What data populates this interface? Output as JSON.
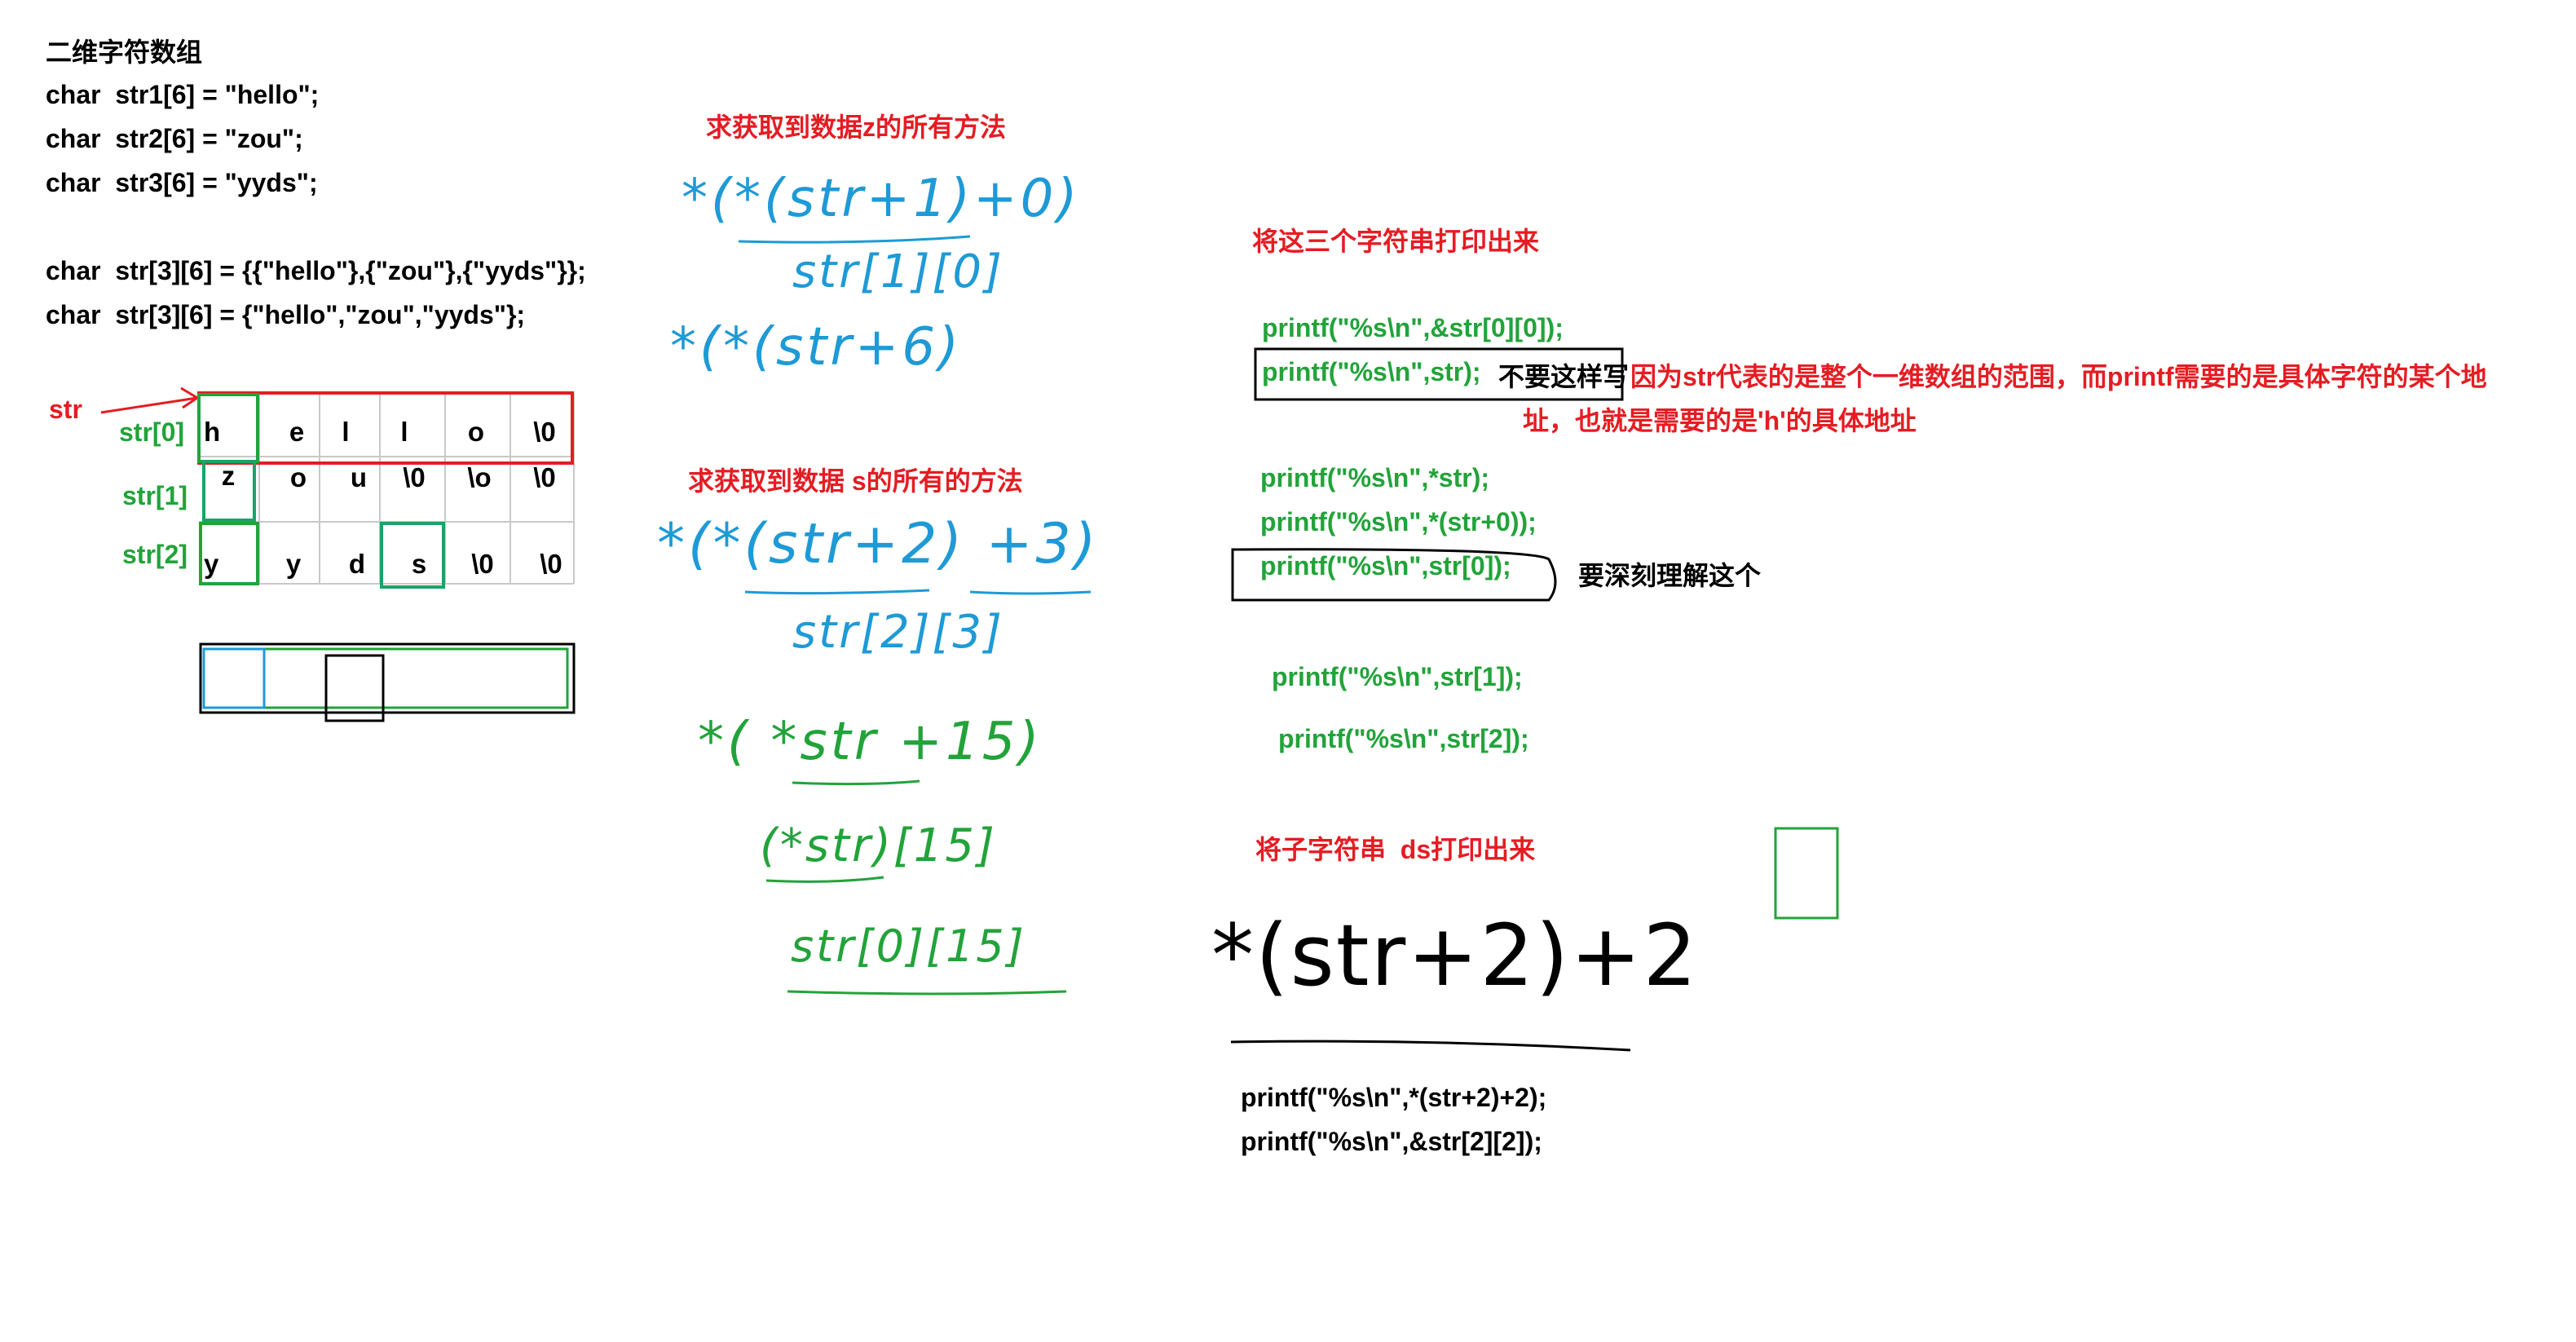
{
  "left": {
    "title": "二维字符数组",
    "code": [
      "char  str1[6] = \"hello\";",
      "char  str2[6] = \"zou\";",
      "char  str3[6] = \"yyds\";",
      "char  str[3][6] = {{\"hello\"},{\"zou\"},{\"yyds\"}};",
      "char  str[3][6] = {\"hello\",\"zou\",\"yyds\"};"
    ],
    "pointer_label": "str",
    "row_labels": [
      "str[0]",
      "str[1]",
      "str[2]"
    ],
    "grid": [
      [
        "h",
        "e",
        "l",
        "l",
        "o",
        "\\0"
      ],
      [
        "z",
        "o",
        "u",
        "\\0",
        "\\o",
        "\\0"
      ],
      [
        "y",
        "y",
        "d",
        "s",
        "\\0",
        "\\0"
      ]
    ]
  },
  "middle": {
    "heading_z": "求获取到数据z的所有方法",
    "hand_z": [
      "*(*(str+1)+0)",
      "str[1][0]",
      "*(*(str+6)"
    ],
    "heading_s": "求获取到数据 s的所有的方法",
    "hand_s": [
      "*(*(str+2) +3)",
      "str[2][3]",
      "*( *str +15)",
      "(*str)[15]",
      "str[0][15]"
    ]
  },
  "right": {
    "heading_print": "将这三个字符串打印出来",
    "printf": [
      "printf(\"%s\\n\",&str[0][0]);",
      "printf(\"%s\\n\",str);",
      "printf(\"%s\\n\",*str);",
      "printf(\"%s\\n\",*(str+0));",
      "printf(\"%s\\n\",str[0]);",
      "printf(\"%s\\n\",str[1]);",
      "printf(\"%s\\n\",str[2]);"
    ],
    "no_write": "不要这样写",
    "explain_1": "因为str代表的是整个一维数组的范围，而printf需要的是具体字符的某个地",
    "explain_2": "址，也就是需要的是'h'的具体地址",
    "deep_note": "要深刻理解这个",
    "heading_sub": "将子字符串  ds打印出来",
    "hand_sub": "*(str+2)+2",
    "printf_sub": [
      "printf(\"%s\\n\",*(str+2)+2);",
      "printf(\"%s\\n\",&str[2][2]);"
    ]
  },
  "colors": {
    "red": "#e51c23",
    "green": "#22a33a",
    "blue": "#1e9ad6",
    "black": "#000000"
  }
}
